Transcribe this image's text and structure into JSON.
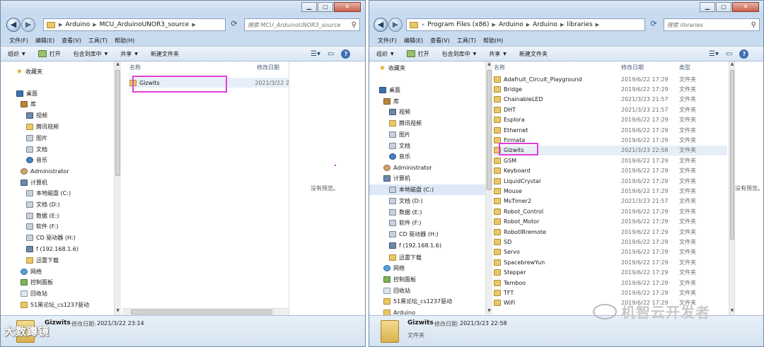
{
  "left": {
    "address": [
      "Arduino",
      "MCU_ArduinoUNOR3_source"
    ],
    "search_placeholder": "搜索 MCU_ArduinoUNOR3_source",
    "menu": [
      "文件(F)",
      "编辑(E)",
      "查看(V)",
      "工具(T)",
      "帮助(H)"
    ],
    "toolbar": [
      "组织",
      "打开",
      "包含到库中",
      "共享",
      "新建文件夹"
    ],
    "nav": [
      {
        "label": "收藏夹",
        "icon": "star-icon"
      },
      {
        "label": "桌面",
        "icon": "desktop-icon"
      },
      {
        "label": "库",
        "icon": "library-icon"
      },
      {
        "label": "视频",
        "icon": "video-icon"
      },
      {
        "label": "腾讯视频",
        "icon": "folder-icon"
      },
      {
        "label": "图片",
        "icon": "picture-icon"
      },
      {
        "label": "文档",
        "icon": "document-icon"
      },
      {
        "label": "音乐",
        "icon": "music-icon"
      },
      {
        "label": "Administrator",
        "icon": "user-icon"
      },
      {
        "label": "计算机",
        "icon": "computer-icon"
      },
      {
        "label": "本地磁盘 (C:)",
        "icon": "drive-icon"
      },
      {
        "label": "文档 (D:)",
        "icon": "drive-icon"
      },
      {
        "label": "数据 (E:)",
        "icon": "drive-icon"
      },
      {
        "label": "软件 (F:)",
        "icon": "drive-icon"
      },
      {
        "label": "CD 驱动器 (H:)",
        "icon": "cd-drive-icon"
      },
      {
        "label": "f (192.168.1.6)",
        "icon": "network-drive-icon"
      },
      {
        "label": "迅雷下载",
        "icon": "folder-icon"
      },
      {
        "label": "网络",
        "icon": "network-icon"
      },
      {
        "label": "控制面板",
        "icon": "control-panel-icon"
      },
      {
        "label": "回收站",
        "icon": "recycle-bin-icon"
      },
      {
        "label": "51黑论坛_cs1237驱动",
        "icon": "folder-icon"
      }
    ],
    "columns": {
      "name": "名称",
      "date": "修改日期"
    },
    "files": [
      {
        "name": "Gizwits",
        "date": "2021/3/22 2"
      }
    ],
    "preview": "没有预览。",
    "details": {
      "name": "Gizwits",
      "label": "修改日期:",
      "value": "2021/3/22 23:14"
    }
  },
  "right": {
    "address": [
      "Program Files (x86)",
      "Arduino",
      "Arduino",
      "libraries"
    ],
    "search_placeholder": "搜索 libraries",
    "menu": [
      "文件(F)",
      "编辑(E)",
      "查看(V)",
      "工具(T)",
      "帮助(H)"
    ],
    "toolbar": [
      "组织",
      "打开",
      "包含到库中",
      "共享",
      "新建文件夹"
    ],
    "nav": [
      {
        "label": "收藏夹",
        "icon": "star-icon"
      },
      {
        "label": "桌面",
        "icon": "desktop-icon"
      },
      {
        "label": "库",
        "icon": "library-icon"
      },
      {
        "label": "视频",
        "icon": "video-icon"
      },
      {
        "label": "腾讯视频",
        "icon": "folder-icon"
      },
      {
        "label": "图片",
        "icon": "picture-icon"
      },
      {
        "label": "文档",
        "icon": "document-icon"
      },
      {
        "label": "音乐",
        "icon": "music-icon"
      },
      {
        "label": "Administrator",
        "icon": "user-icon"
      },
      {
        "label": "计算机",
        "icon": "computer-icon"
      },
      {
        "label": "本地磁盘 (C:)",
        "icon": "drive-icon"
      },
      {
        "label": "文档 (D:)",
        "icon": "drive-icon"
      },
      {
        "label": "数据 (E:)",
        "icon": "drive-icon"
      },
      {
        "label": "软件 (F:)",
        "icon": "drive-icon"
      },
      {
        "label": "CD 驱动器 (H:)",
        "icon": "cd-drive-icon"
      },
      {
        "label": "f (192.168.1.6)",
        "icon": "network-drive-icon"
      },
      {
        "label": "迅雷下载",
        "icon": "folder-icon"
      },
      {
        "label": "网络",
        "icon": "network-icon"
      },
      {
        "label": "控制面板",
        "icon": "control-panel-icon"
      },
      {
        "label": "回收站",
        "icon": "recycle-bin-icon"
      },
      {
        "label": "51黑论坛_cs1237驱动",
        "icon": "folder-icon"
      },
      {
        "label": "Arduino",
        "icon": "folder-icon"
      }
    ],
    "columns": {
      "name": "名称",
      "date": "修改日期",
      "type": "类型"
    },
    "files": [
      {
        "name": "Adafruit_Circuit_Playground",
        "date": "2019/6/22 17:29",
        "type": "文件夹"
      },
      {
        "name": "Bridge",
        "date": "2019/6/22 17:29",
        "type": "文件夹"
      },
      {
        "name": "ChainableLED",
        "date": "2021/3/23 21:57",
        "type": "文件夹"
      },
      {
        "name": "DHT",
        "date": "2021/3/23 21:57",
        "type": "文件夹"
      },
      {
        "name": "Esplora",
        "date": "2019/6/22 17:29",
        "type": "文件夹"
      },
      {
        "name": "Ethernet",
        "date": "2019/6/22 17:29",
        "type": "文件夹"
      },
      {
        "name": "Firmata",
        "date": "2019/6/22 17:29",
        "type": "文件夹"
      },
      {
        "name": "Gizwits",
        "date": "2021/3/23 22:58",
        "type": "文件夹"
      },
      {
        "name": "GSM",
        "date": "2019/6/22 17:29",
        "type": "文件夹"
      },
      {
        "name": "Keyboard",
        "date": "2019/6/22 17:29",
        "type": "文件夹"
      },
      {
        "name": "LiquidCrystal",
        "date": "2019/6/22 17:29",
        "type": "文件夹"
      },
      {
        "name": "Mouse",
        "date": "2019/6/22 17:29",
        "type": "文件夹"
      },
      {
        "name": "MsTimer2",
        "date": "2021/3/23 21:57",
        "type": "文件夹"
      },
      {
        "name": "Robot_Control",
        "date": "2019/6/22 17:29",
        "type": "文件夹"
      },
      {
        "name": "Robot_Motor",
        "date": "2019/6/22 17:29",
        "type": "文件夹"
      },
      {
        "name": "RobotIRremote",
        "date": "2019/6/22 17:29",
        "type": "文件夹"
      },
      {
        "name": "SD",
        "date": "2019/6/22 17:29",
        "type": "文件夹"
      },
      {
        "name": "Servo",
        "date": "2019/6/22 17:29",
        "type": "文件夹"
      },
      {
        "name": "SpacebrewYun",
        "date": "2019/6/22 17:29",
        "type": "文件夹"
      },
      {
        "name": "Stepper",
        "date": "2019/6/22 17:29",
        "type": "文件夹"
      },
      {
        "name": "Temboo",
        "date": "2019/6/22 17:29",
        "type": "文件夹"
      },
      {
        "name": "TFT",
        "date": "2019/6/22 17:29",
        "type": "文件夹"
      },
      {
        "name": "WiFi",
        "date": "2019/6/22 17:29",
        "type": "文件夹"
      }
    ],
    "preview": "没有预览。",
    "details": {
      "name": "Gizwits",
      "label": "修改日期:",
      "value": "2021/3/23 22:58",
      "type": "文件夹"
    }
  },
  "watermarks": {
    "left": "大数蹲镜",
    "right": "机智云开发者"
  },
  "colors": {
    "highlight": "#e23fd8",
    "chrome": "#c9dbef",
    "folder": "#e9c86a"
  }
}
